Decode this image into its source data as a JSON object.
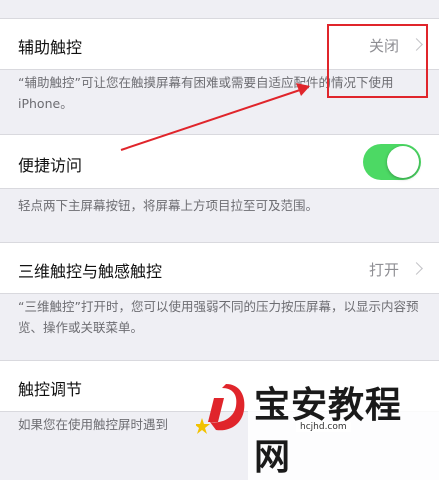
{
  "rows": {
    "assistive_touch": {
      "label": "辅助触控",
      "value": "关闭"
    },
    "assistive_touch_desc": "“辅助触控”可让您在触摸屏幕有困难或需要自适应配件的情况下使用iPhone。",
    "reachability": {
      "label": "便捷访问",
      "toggle_on": true
    },
    "reachability_desc": "轻点两下主屏幕按钮，将屏幕上方项目拉至可及范围。",
    "touch_3d": {
      "label": "三维触控与触感触控",
      "value": "打开"
    },
    "touch_3d_desc": "“三维触控”打开时，您可以使用强弱不同的压力按压屏幕，以显示内容预览、操作或关联菜单。",
    "touch_accommodations": {
      "label": "触控调节"
    },
    "touch_accommodations_desc": "如果您在使用触控屏时遇到"
  },
  "annotation_color": "#e0252b",
  "toggle_color": "#4cd964",
  "watermark": {
    "title": "宝安教程网",
    "url": "hcjhd.com"
  }
}
